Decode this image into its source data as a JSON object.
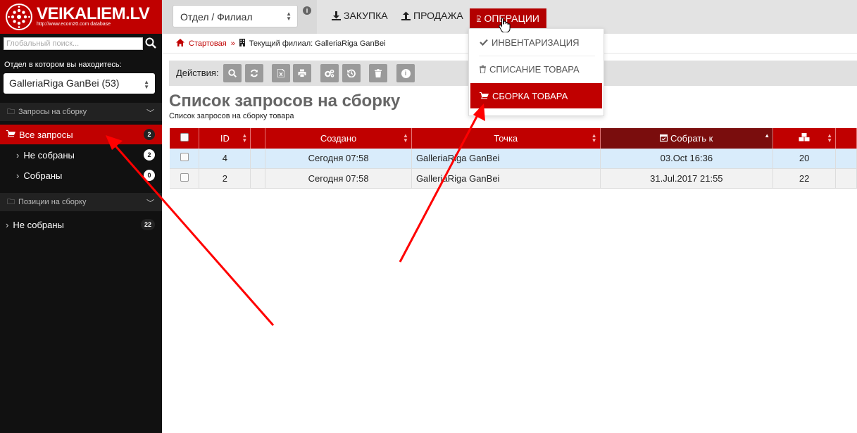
{
  "brand": {
    "name": "VEIKALIEM.LV",
    "tagline": "http://www.ecom20.com database"
  },
  "topbar": {
    "dept_select": "Отдел / Филиал",
    "nav": [
      {
        "label": "ЗАКУПКА",
        "icon": "download-icon"
      },
      {
        "label": "ПРОДАЖА",
        "icon": "upload-icon"
      },
      {
        "label": "ОПЕРАЦИИ",
        "icon": "document-icon"
      }
    ]
  },
  "dropdown": {
    "items": [
      {
        "label": "ИНВЕНТАРИЗАЦИЯ",
        "icon": "check-icon"
      },
      {
        "label": "СПИСАНИЕ ТОВАРА",
        "icon": "trash-icon"
      },
      {
        "label": "СБОРКА ТОВАРА",
        "icon": "cart-icon"
      }
    ]
  },
  "sidebar": {
    "search_placeholder": "Глобальный поиск...",
    "dept_label": "Отдел в котором вы находитесь:",
    "dept_value": "GalleriaRiga GanBei (53)",
    "groups": [
      {
        "title": "Запросы на сборку",
        "items": [
          {
            "label": "Все запросы",
            "count": "2"
          },
          {
            "label": "Не собраны",
            "count": "2"
          },
          {
            "label": "Собраны",
            "count": "0"
          }
        ]
      },
      {
        "title": "Позиции на сборку",
        "items": [
          {
            "label": "Не собраны",
            "count": "22"
          }
        ]
      }
    ]
  },
  "breadcrumb": {
    "home": "Стартовая",
    "sep": "»",
    "current": "Текущий филиал: GalleriaRiga GanBei"
  },
  "actions": {
    "label": "Действия:"
  },
  "page": {
    "title": "Список запросов на сборку",
    "subtitle": "Список запросов на сборку товара"
  },
  "table": {
    "headers": [
      "ID",
      "Создано",
      "Точка",
      "Собрать к"
    ],
    "rows": [
      {
        "id": "4",
        "created": "Сегодня 07:58",
        "point": "GalleriaRiga GanBei",
        "collect_by": "03.Oct 16:36",
        "qty": "20"
      },
      {
        "id": "2",
        "created": "Сегодня 07:58",
        "point": "GalleriaRiga GanBei",
        "collect_by": "31.Jul.2017 21:55",
        "qty": "22"
      }
    ]
  },
  "colors": {
    "brand_red": "#c00000",
    "dark": "#111111",
    "annotation_red": "#ff0000"
  }
}
